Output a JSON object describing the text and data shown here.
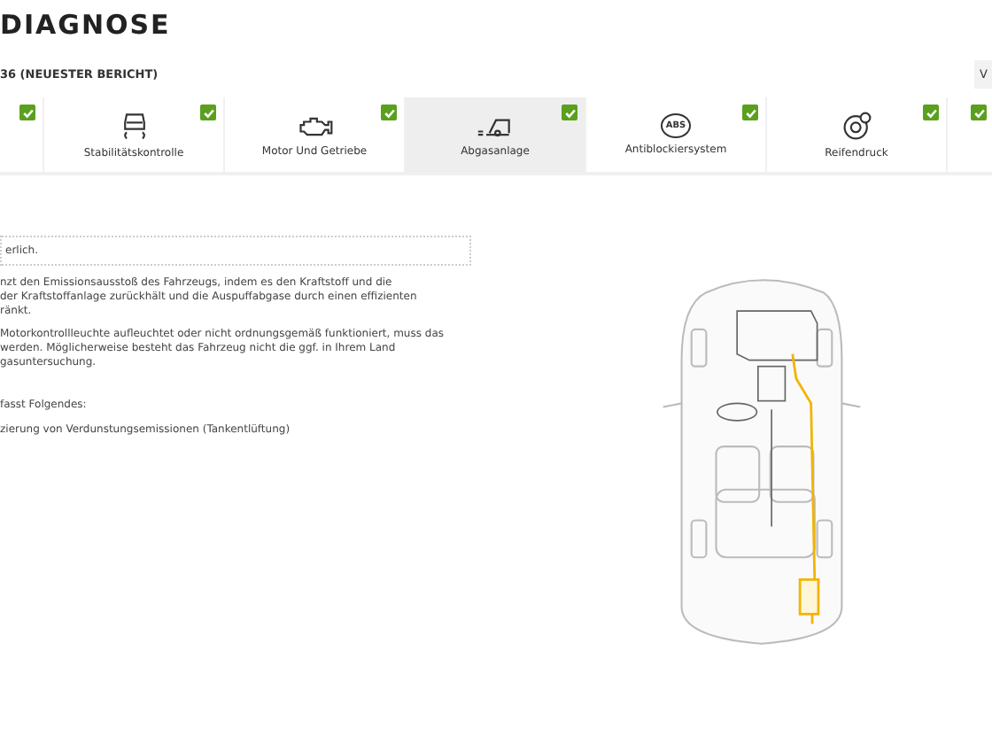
{
  "title": "DIAGNOSE",
  "report": "36 (NEUESTER BERICHT)",
  "corner_button": "V",
  "tabs": [
    {
      "checked": true,
      "selected": false
    },
    {
      "label": "Stabilitätskontrolle",
      "kind": "stability",
      "checked": true,
      "selected": false
    },
    {
      "label": "Motor Und Getriebe",
      "kind": "engine",
      "checked": true,
      "selected": false
    },
    {
      "label": "Abgasanlage",
      "kind": "exhaust",
      "checked": true,
      "selected": true
    },
    {
      "label": "Antiblockiersystem",
      "kind": "abs",
      "checked": true,
      "selected": false
    },
    {
      "label": "Reifendruck",
      "kind": "tire",
      "checked": true,
      "selected": false
    },
    {
      "checked": true,
      "selected": false
    }
  ],
  "status_field": "erlich.",
  "paragraphs": [
    "nzt den Emissionsausstoß des Fahrzeugs, indem es den Kraftstoff und die\nder Kraftstoffanlage zurückhält und die Auspuffabgase durch einen effizienten\nränkt.",
    "Motorkontrollleuchte aufleuchtet oder nicht ordnungsgemäß funktioniert, muss das\nwerden. Möglicherweise besteht das Fahrzeug nicht die ggf. in Ihrem Land\ngasuntersuchung."
  ],
  "list_heading": "fasst Folgendes:",
  "list_items": [
    "zierung von Verdunstungsemissionen (Tankentlüftung)"
  ],
  "abs_icon_text": "ABS"
}
